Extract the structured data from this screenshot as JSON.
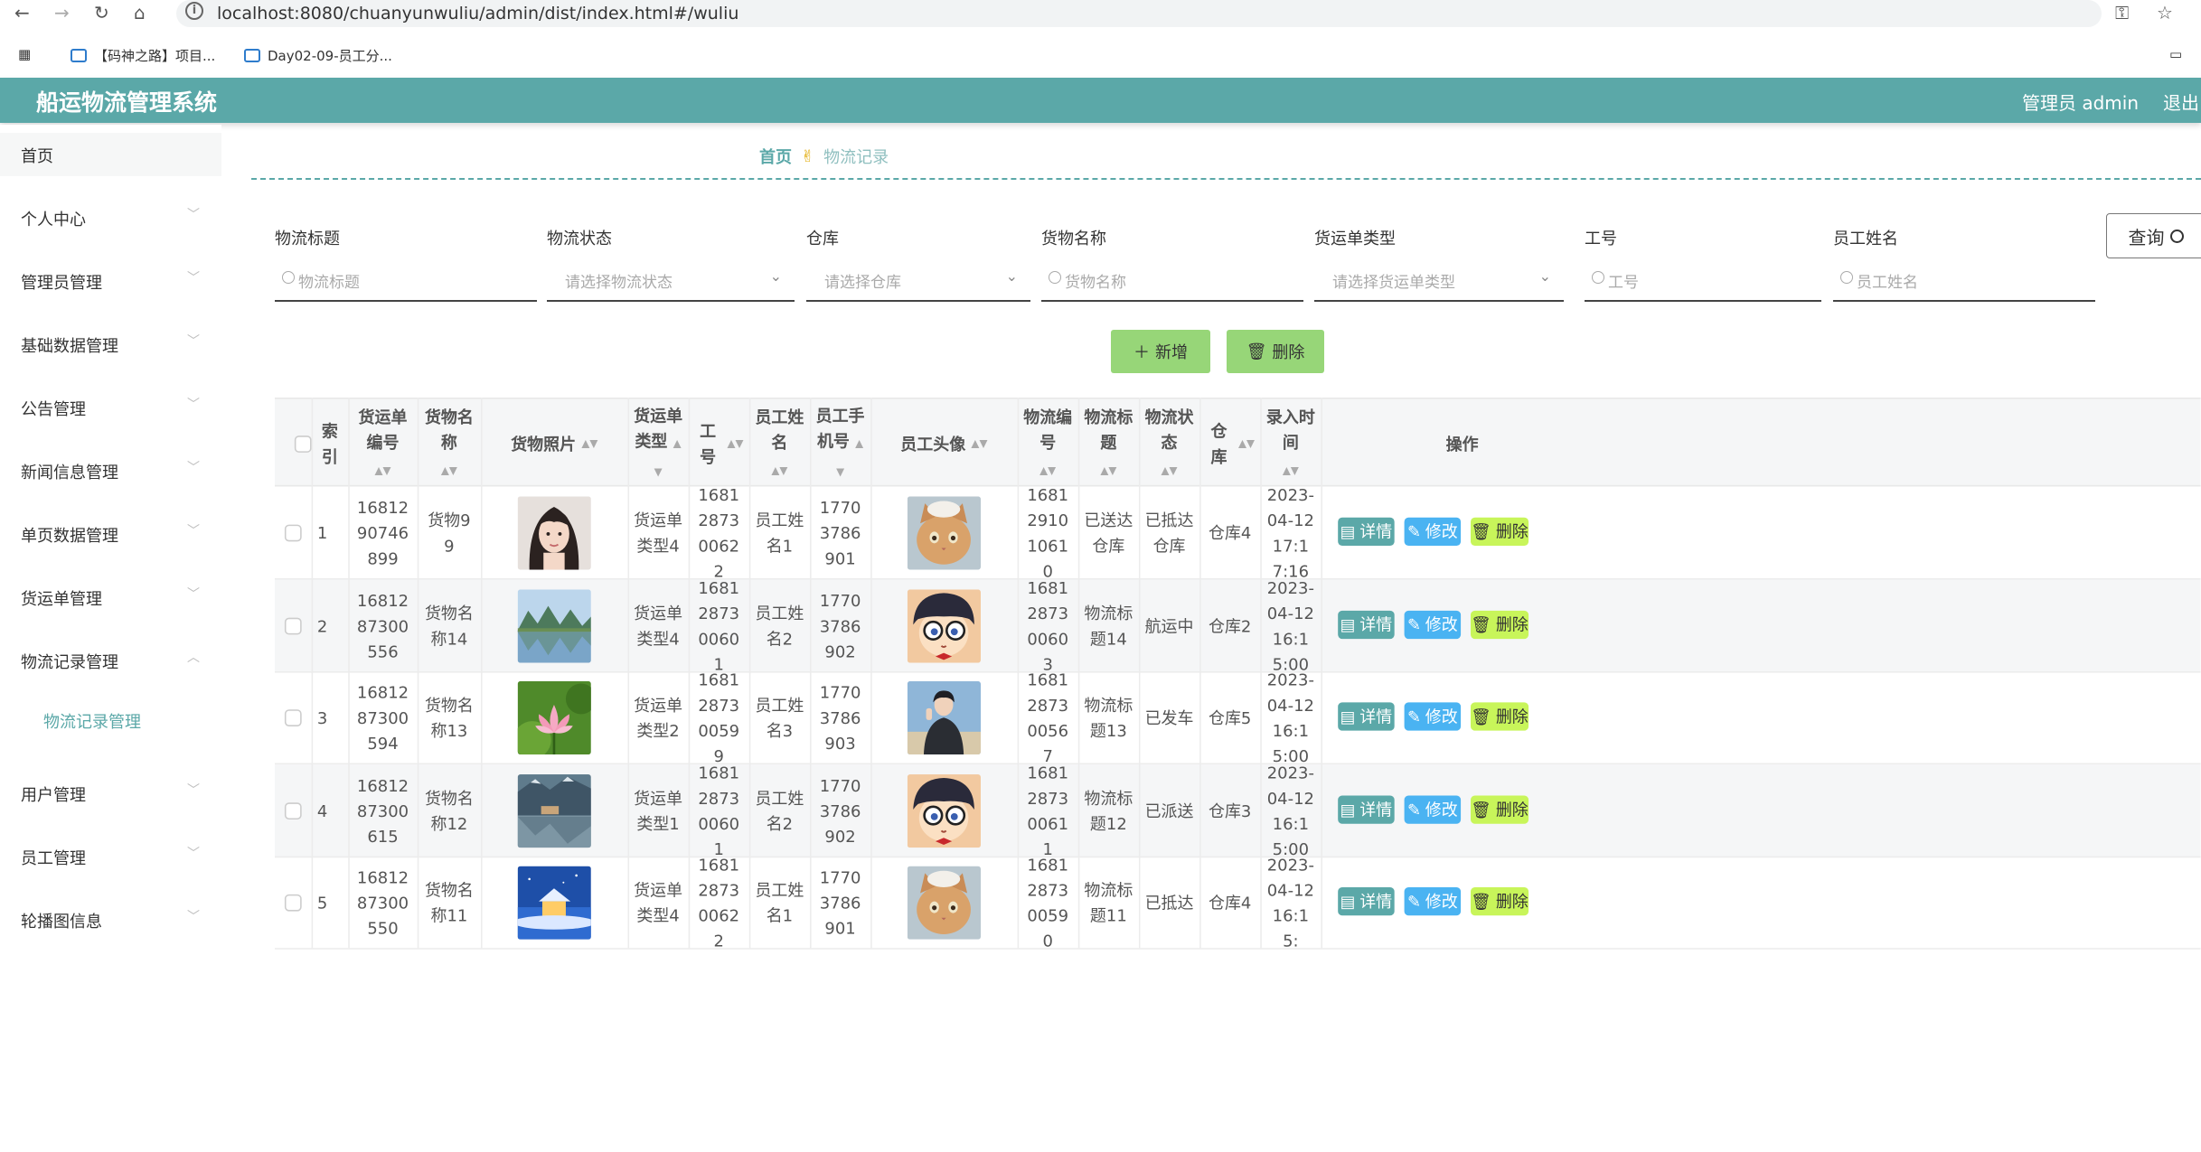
{
  "browser": {
    "url": "localhost:8080/chuanyunwuliu/admin/dist/index.html#/wuliu",
    "bookmarks": [
      "【码神之路】项目...",
      "Day02-09-员工分..."
    ]
  },
  "header": {
    "title": "船运物流管理系统",
    "admin": "管理员 admin",
    "logout": "退出"
  },
  "sidebar": {
    "items": [
      {
        "label": "首页"
      },
      {
        "label": "个人中心"
      },
      {
        "label": "管理员管理"
      },
      {
        "label": "基础数据管理"
      },
      {
        "label": "公告管理"
      },
      {
        "label": "新闻信息管理"
      },
      {
        "label": "单页数据管理"
      },
      {
        "label": "货运单管理"
      },
      {
        "label": "物流记录管理"
      },
      {
        "label": "用户管理"
      },
      {
        "label": "员工管理"
      },
      {
        "label": "轮播图信息"
      }
    ],
    "sub_item": "物流记录管理"
  },
  "breadcrumb": {
    "home": "首页",
    "current": "物流记录"
  },
  "filters": [
    {
      "label": "物流标题",
      "placeholder": "物流标题"
    },
    {
      "label": "物流状态",
      "placeholder": "请选择物流状态"
    },
    {
      "label": "仓库",
      "placeholder": "请选择仓库"
    },
    {
      "label": "货物名称",
      "placeholder": "货物名称"
    },
    {
      "label": "货运单类型",
      "placeholder": "请选择货运单类型"
    },
    {
      "label": "工号",
      "placeholder": "工号"
    },
    {
      "label": "员工姓名",
      "placeholder": "员工姓名"
    }
  ],
  "buttons": {
    "query": "查询",
    "add": "新增",
    "delete": "删除"
  },
  "table": {
    "headers": [
      "索引",
      "货运单编号",
      "货物名称",
      "货物照片",
      "货运单类型",
      "工号",
      "员工姓名",
      "员工手机号",
      "员工头像",
      "物流编号",
      "物流标题",
      "物流状态",
      "仓库",
      "录入时间",
      "操作"
    ],
    "action_labels": {
      "detail": "详情",
      "edit": "修改",
      "delete": "删除"
    },
    "rows": [
      {
        "index": "1",
        "order_no": "1681290746899",
        "goods_name": "货物99",
        "photo": "portrait-girl",
        "order_type": "货运单类型4",
        "emp_no": "1681287300622",
        "emp_name": "员工姓名1",
        "phone": "17703786901",
        "avatar": "cat",
        "wuliu_no": "1681291010610",
        "title": "已送达仓库",
        "status": "已抵达仓库",
        "warehouse": "仓库4",
        "time": "2023-04-12 17:17:16"
      },
      {
        "index": "2",
        "order_no": "1681287300556",
        "goods_name": "货物名称14",
        "photo": "mountain-lake",
        "order_type": "货运单类型4",
        "emp_no": "1681287300601",
        "emp_name": "员工姓名2",
        "phone": "17703786902",
        "avatar": "cartoon-boy",
        "wuliu_no": "1681287300603",
        "title": "物流标题14",
        "status": "航运中",
        "warehouse": "仓库2",
        "time": "2023-04-12 16:15:00"
      },
      {
        "index": "3",
        "order_no": "1681287300594",
        "goods_name": "货物名称13",
        "photo": "lotus",
        "order_type": "货运单类型2",
        "emp_no": "1681287300599",
        "emp_name": "员工姓名3",
        "phone": "17703786903",
        "avatar": "young-man",
        "wuliu_no": "1681287300567",
        "title": "物流标题13",
        "status": "已发车",
        "warehouse": "仓库5",
        "time": "2023-04-12 16:15:00"
      },
      {
        "index": "4",
        "order_no": "1681287300615",
        "goods_name": "货物名称12",
        "photo": "alpine-village",
        "order_type": "货运单类型1",
        "emp_no": "1681287300601",
        "emp_name": "员工姓名2",
        "phone": "17703786902",
        "avatar": "cartoon-boy",
        "wuliu_no": "1681287300611",
        "title": "物流标题12",
        "status": "已派送",
        "warehouse": "仓库3",
        "time": "2023-04-12 16:15:00"
      },
      {
        "index": "5",
        "order_no": "1681287300550",
        "goods_name": "货物名称11",
        "photo": "snow-night",
        "order_type": "货运单类型4",
        "emp_no": "1681287300622",
        "emp_name": "员工姓名1",
        "phone": "17703786901",
        "avatar": "cat",
        "wuliu_no": "1681287300590",
        "title": "物流标题11",
        "status": "已抵达",
        "warehouse": "仓库4",
        "time": "2023-04-12 16:15:"
      }
    ]
  }
}
